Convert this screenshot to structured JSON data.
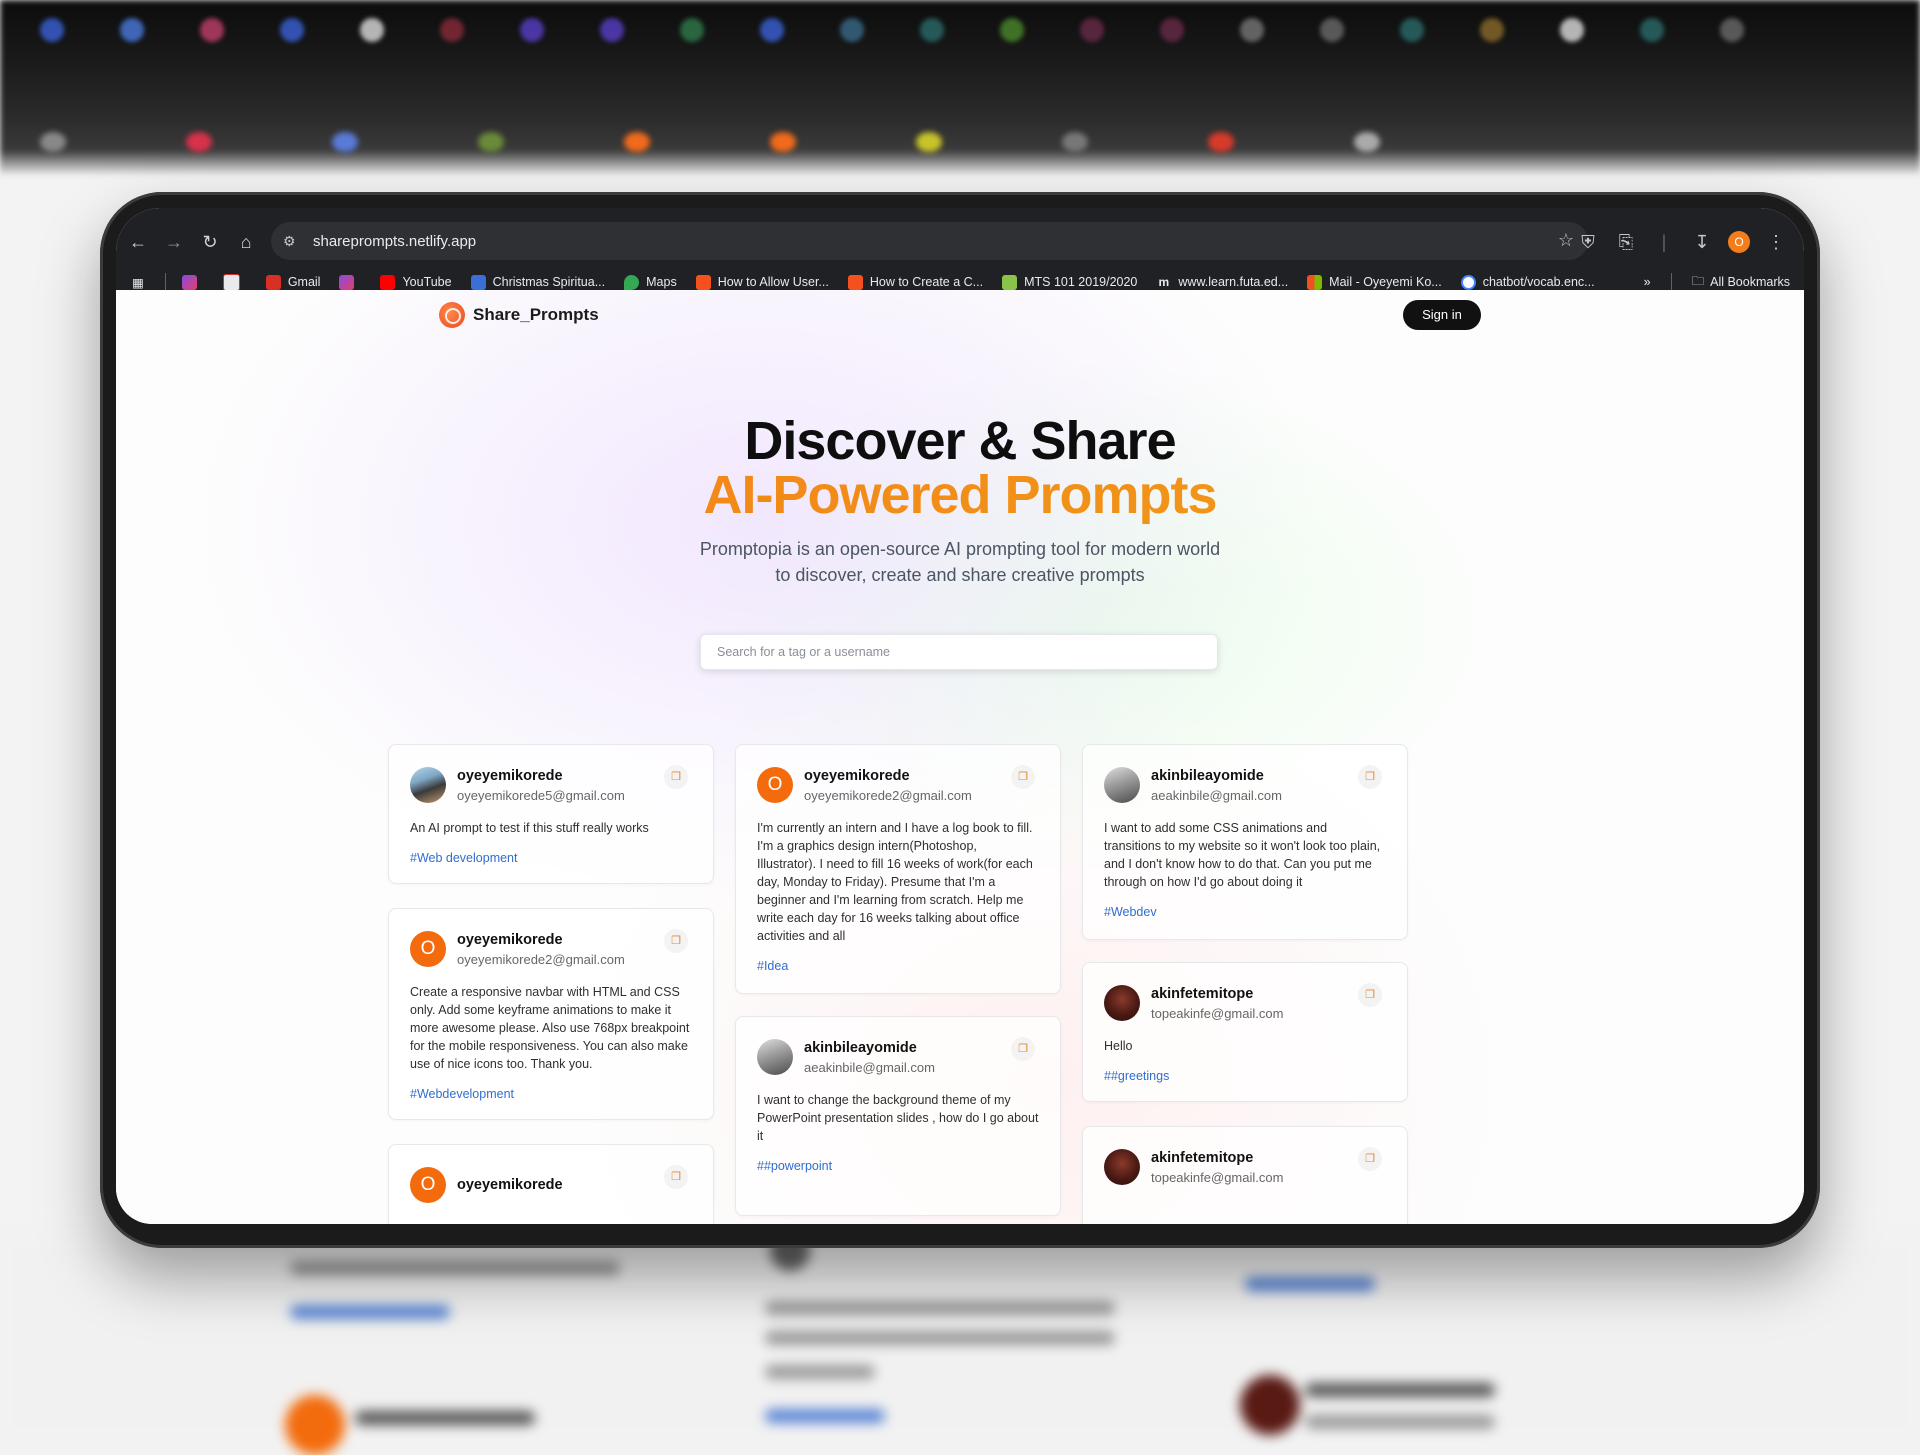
{
  "browser": {
    "url": "shareprompts.netlify.app",
    "profile_initial": "O",
    "bookmarks": [
      {
        "label": "Gmail",
        "color": "#d93025"
      },
      {
        "label": "YouTube",
        "color": "#ff0000"
      },
      {
        "label": "Christmas Spiritua...",
        "color": "#3b6fd8"
      },
      {
        "label": "Maps",
        "color": "#34a853"
      },
      {
        "label": "How to Allow User...",
        "color": "#f4511e"
      },
      {
        "label": "How to Create a C...",
        "color": "#f4511e"
      },
      {
        "label": "MTS 101 2019/2020",
        "color": "#8bc34a"
      },
      {
        "label": "www.learn.futa.ed...",
        "color": "#e8eaed"
      },
      {
        "label": "Mail - Oyeyemi Ko...",
        "color": "#f25022"
      },
      {
        "label": "chatbot/vocab.enc...",
        "color": "#4285f4"
      }
    ],
    "all_bookmarks": "All Bookmarks"
  },
  "site": {
    "brand": "Share_Prompts",
    "signin": "Sign in",
    "hero_line1": "Discover & Share",
    "hero_line2": "AI-Powered Prompts",
    "subtitle": "Promptopia is an open-source AI prompting tool for modern world to discover, create and share creative prompts",
    "search_placeholder": "Search for a tag or a username"
  },
  "cards": [
    [
      {
        "username": "oyeyemikorede",
        "email": "oyeyemikorede5@gmail.com",
        "avatar": "photo1",
        "initial": "",
        "text": "An AI prompt to test if this stuff really works",
        "tag": "#Web development"
      },
      {
        "username": "oyeyemikorede",
        "email": "oyeyemikorede2@gmail.com",
        "avatar": "letter",
        "initial": "O",
        "text": "Create a responsive navbar with HTML and CSS only. Add some keyframe animations to make it more awesome please. Also use 768px breakpoint for the mobile responsiveness. You can also make use of nice icons too. Thank you.",
        "tag": "#Webdevelopment"
      },
      {
        "username": "oyeyemikorede",
        "email": "",
        "avatar": "letter",
        "initial": "O",
        "text": "",
        "tag": ""
      }
    ],
    [
      {
        "username": "oyeyemikorede",
        "email": "oyeyemikorede2@gmail.com",
        "avatar": "letter",
        "initial": "O",
        "text": "I'm currently an intern and I have a log book to fill. I'm a graphics design intern(Photoshop, Illustrator). I need to fill 16 weeks of work(for each day, Monday to Friday). Presume that I'm a beginner and I'm learning from scratch. Help me write each day for 16 weeks talking about office activities and all",
        "tag": "#Idea"
      },
      {
        "username": "akinbileayomide",
        "email": "aeakinbile@gmail.com",
        "avatar": "photo2",
        "initial": "",
        "text": "I want to change the background theme of my PowerPoint presentation slides , how do I go about it",
        "tag": "##powerpoint"
      }
    ],
    [
      {
        "username": "akinbileayomide",
        "email": "aeakinbile@gmail.com",
        "avatar": "photo2",
        "initial": "",
        "text": "I want to add some CSS animations and transitions to my website so it won't look too plain, and I don't know how to do that. Can you put me through on how I'd go about doing it",
        "tag": "#Webdev"
      },
      {
        "username": "akinfetemitope",
        "email": "topeakinfe@gmail.com",
        "avatar": "photo3",
        "initial": "",
        "text": "Hello",
        "tag": "##greetings"
      },
      {
        "username": "akinfetemitope",
        "email": "topeakinfe@gmail.com",
        "avatar": "photo3",
        "initial": "",
        "text": "",
        "tag": ""
      }
    ]
  ]
}
